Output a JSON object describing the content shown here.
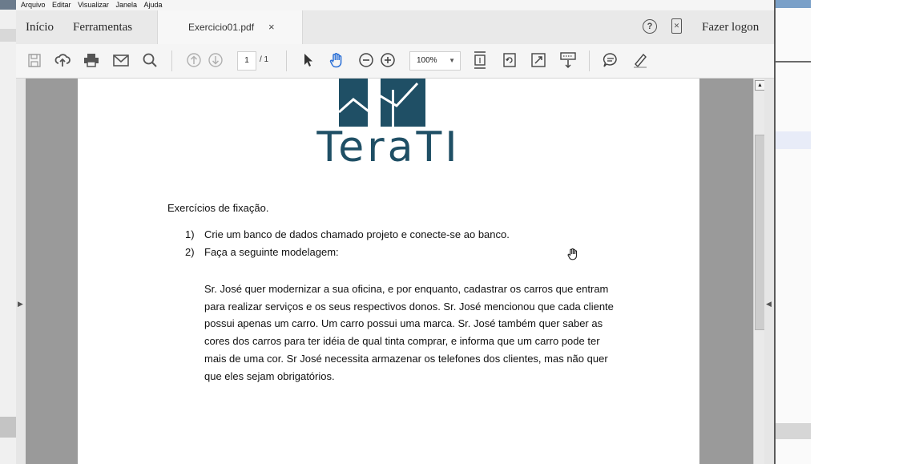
{
  "menubar": {
    "items": [
      "Arquivo",
      "Editar",
      "Visualizar",
      "Janela",
      "Ajuda"
    ]
  },
  "tabbar": {
    "home_label": "Início",
    "tools_label": "Ferramentas",
    "document_tab": "Exercicio01.pdf",
    "close_symbol": "×",
    "help_symbol": "?",
    "signin_label": "Fazer logon"
  },
  "toolbar": {
    "page_current": "1",
    "page_total": "/ 1",
    "zoom_value": "100%"
  },
  "document": {
    "logo_text": "TeraTI",
    "logo_color": "#1f4f65",
    "heading": "Exercícios de fixação.",
    "items": [
      {
        "num": "1)",
        "text": "Crie um banco de dados chamado projeto e conecte-se ao banco."
      },
      {
        "num": "2)",
        "text": "Faça a seguinte modelagem:"
      }
    ],
    "paragraph_lines": [
      "Sr. José quer modernizar a sua oficina, e por enquanto, cadastrar os carros que entram",
      "para realizar serviços e os seus respectivos donos. Sr. José mencionou que cada cliente",
      "possui apenas um carro. Um carro possui uma marca. Sr. José também quer saber as",
      "cores dos carros para ter idéia de qual tinta comprar, e informa que um carro pode ter",
      "mais de uma cor. Sr José necessita armazenar os telefones dos clientes, mas não quer",
      "que eles sejam obrigatórios."
    ]
  },
  "icons": {
    "save": "save-icon",
    "upload": "upload-icon",
    "print": "print-icon",
    "email": "email-icon",
    "search": "search-icon",
    "prev_page": "arrow-up-circle-icon",
    "next_page": "arrow-down-circle-icon",
    "select": "pointer-icon",
    "hand": "hand-icon",
    "zoom_out": "zoom-out-icon",
    "zoom_in": "zoom-in-icon",
    "accent_hand": "#2a6fd6"
  }
}
